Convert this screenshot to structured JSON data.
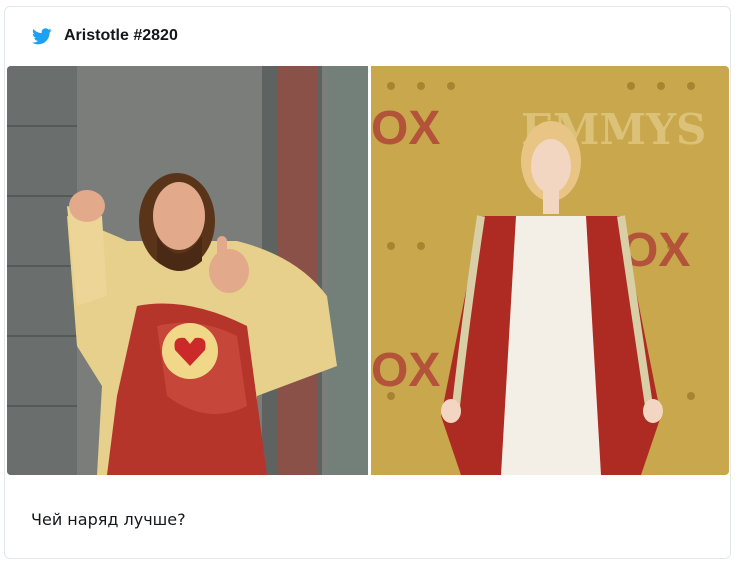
{
  "tweet": {
    "author_handle": "Aristotle #2820",
    "text": "Чей наряд лучше?",
    "icon": "twitter-bird-icon",
    "brand_color": "#1da1f2"
  },
  "media": {
    "images": [
      {
        "description_icon": "statue-photo"
      },
      {
        "description_icon": "red-carpet-photo",
        "backdrop_text": "EMMYS"
      }
    ]
  }
}
